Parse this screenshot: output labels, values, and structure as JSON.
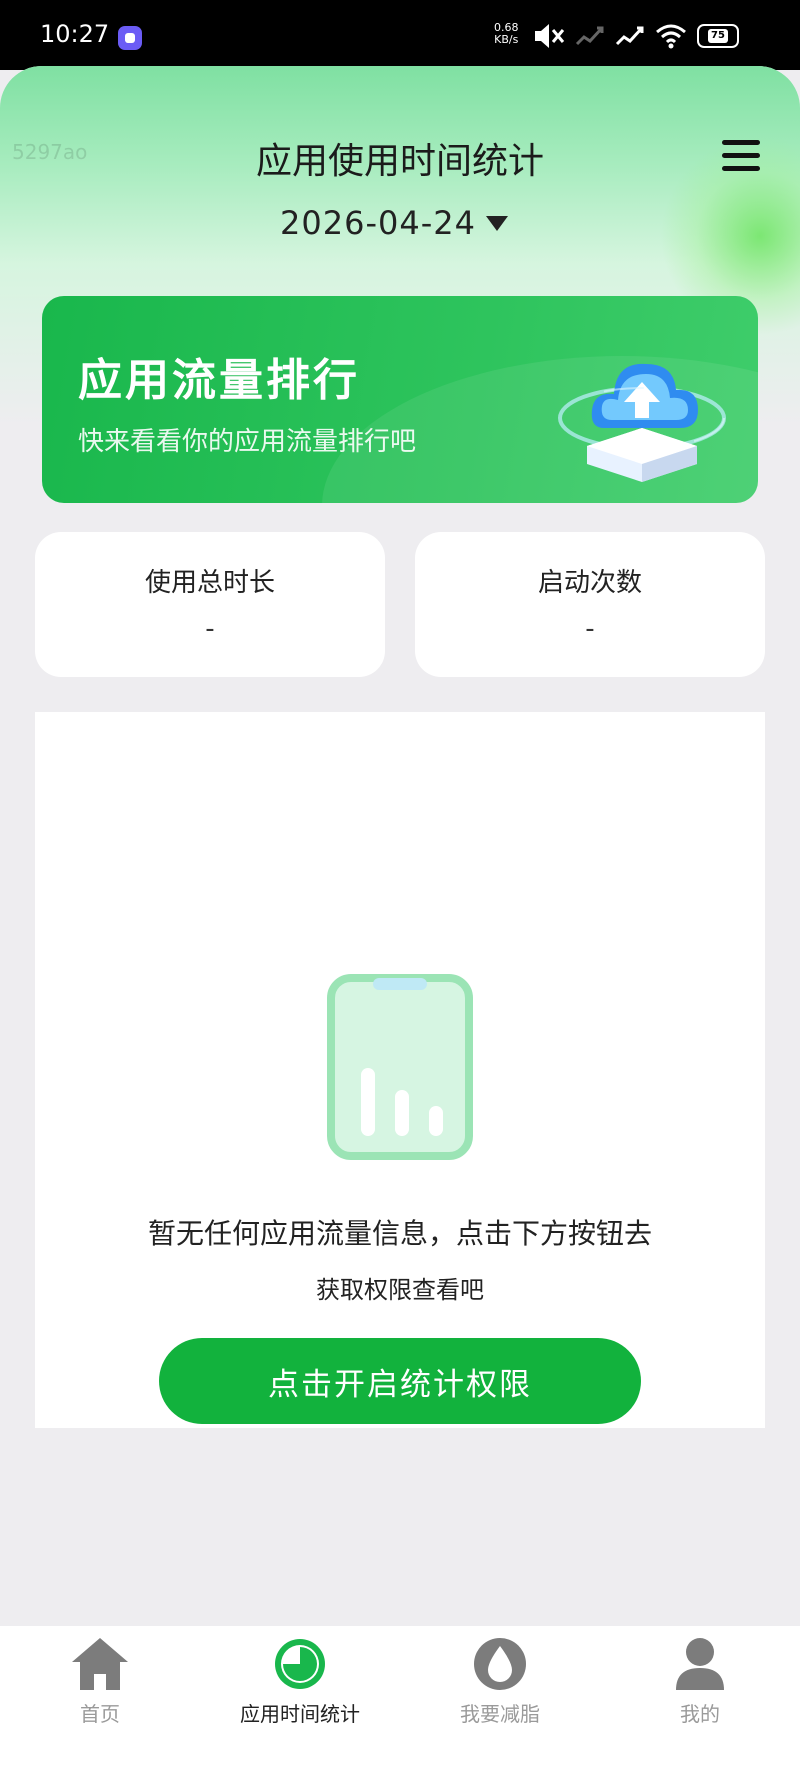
{
  "status_bar": {
    "time": "10:27",
    "net_speed": "0.68",
    "net_unit": "KB/s",
    "battery": "75",
    "icons": [
      "app-notification-icon",
      "mute-icon",
      "signal-icon",
      "signal-icon",
      "wifi-icon",
      "battery-icon"
    ]
  },
  "header": {
    "watermark": "5297ao",
    "title": "应用使用时间统计",
    "date": "2026-04-24"
  },
  "banner": {
    "title": "应用流量排行",
    "subtitle": "快来看看你的应用流量排行吧"
  },
  "stats": [
    {
      "label": "使用总时长",
      "value": "-"
    },
    {
      "label": "启动次数",
      "value": "-"
    }
  ],
  "empty_state": {
    "line1": "暂无任何应用流量信息，点击下方按钮去",
    "line2": "获取权限查看吧",
    "button": "点击开启统计权限"
  },
  "bottom_nav": {
    "items": [
      {
        "label": "首页",
        "icon": "home-icon",
        "active": false
      },
      {
        "label": "应用时间统计",
        "icon": "pie-chart-icon",
        "active": true
      },
      {
        "label": "我要减脂",
        "icon": "water-drop-icon",
        "active": false
      },
      {
        "label": "我的",
        "icon": "user-icon",
        "active": false
      }
    ]
  },
  "colors": {
    "accent": "#12b23d",
    "banner": "#2ec45d",
    "background": "#eeedf0"
  }
}
